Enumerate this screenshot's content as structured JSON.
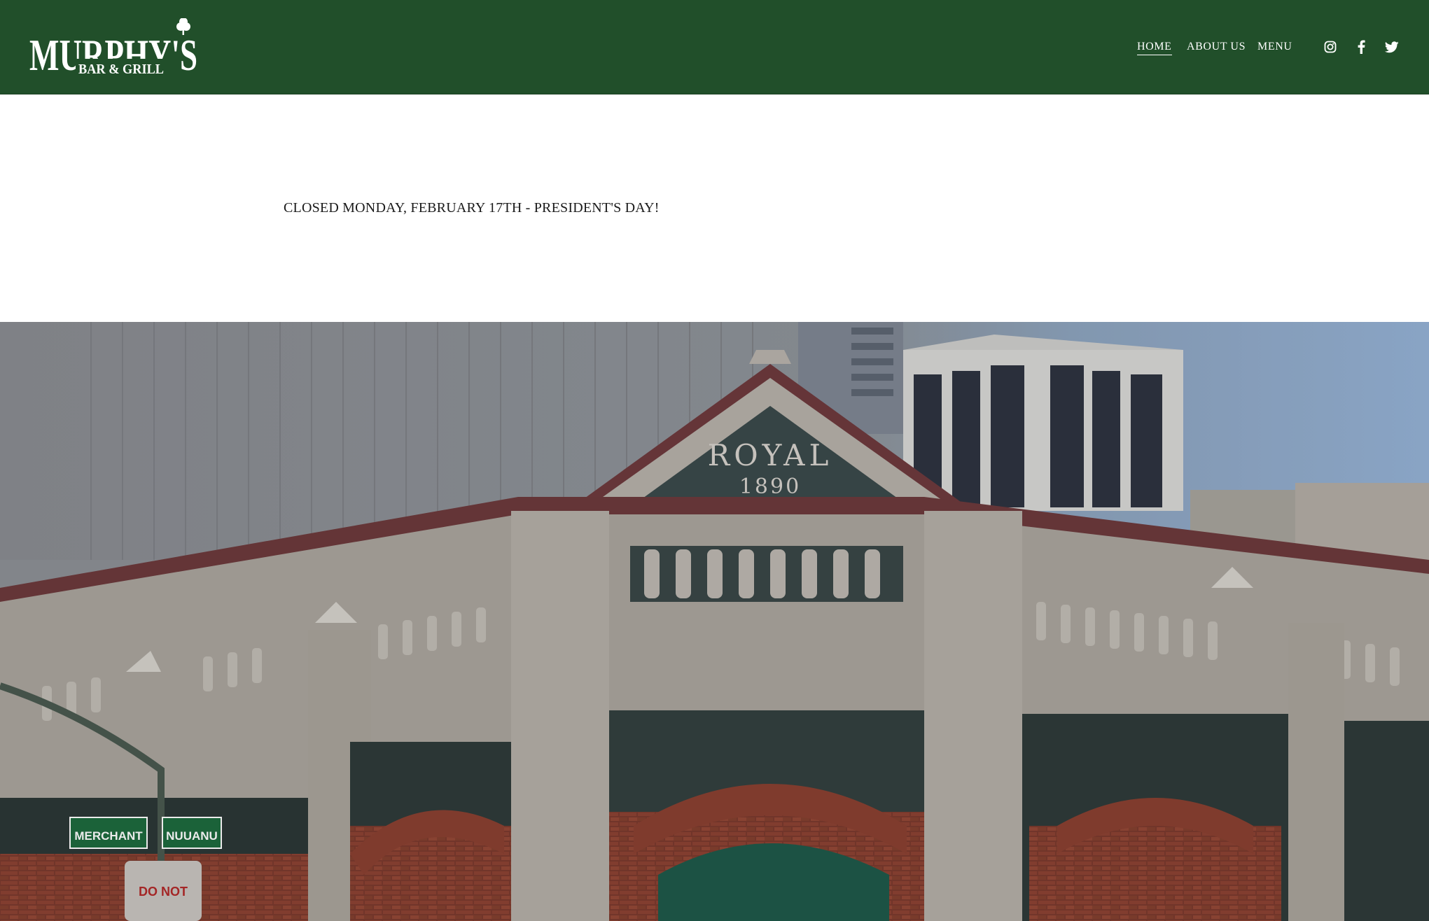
{
  "brand": {
    "logo_main": "MURPHY'S",
    "logo_sub": "BAR & GRILL"
  },
  "nav": {
    "items": [
      {
        "label": "HOME",
        "active": true
      },
      {
        "label": "ABOUT US",
        "active": false
      },
      {
        "label": "MENU",
        "active": false
      }
    ]
  },
  "social": {
    "icons": [
      "instagram-icon",
      "facebook-icon",
      "twitter-icon"
    ]
  },
  "announcement": {
    "text": "CLOSED MONDAY, FEBRUARY 17TH - PRESIDENT'S DAY!"
  },
  "hero": {
    "building_sign_top": "ROYAL",
    "building_sign_year": "1890",
    "street_sign_1": "MERCHANT",
    "street_sign_2": "NUUANU",
    "do_not_sign": "DO NOT"
  },
  "colors": {
    "header_bg": "#214f2a",
    "text": "#1a1a1a",
    "white": "#ffffff"
  }
}
